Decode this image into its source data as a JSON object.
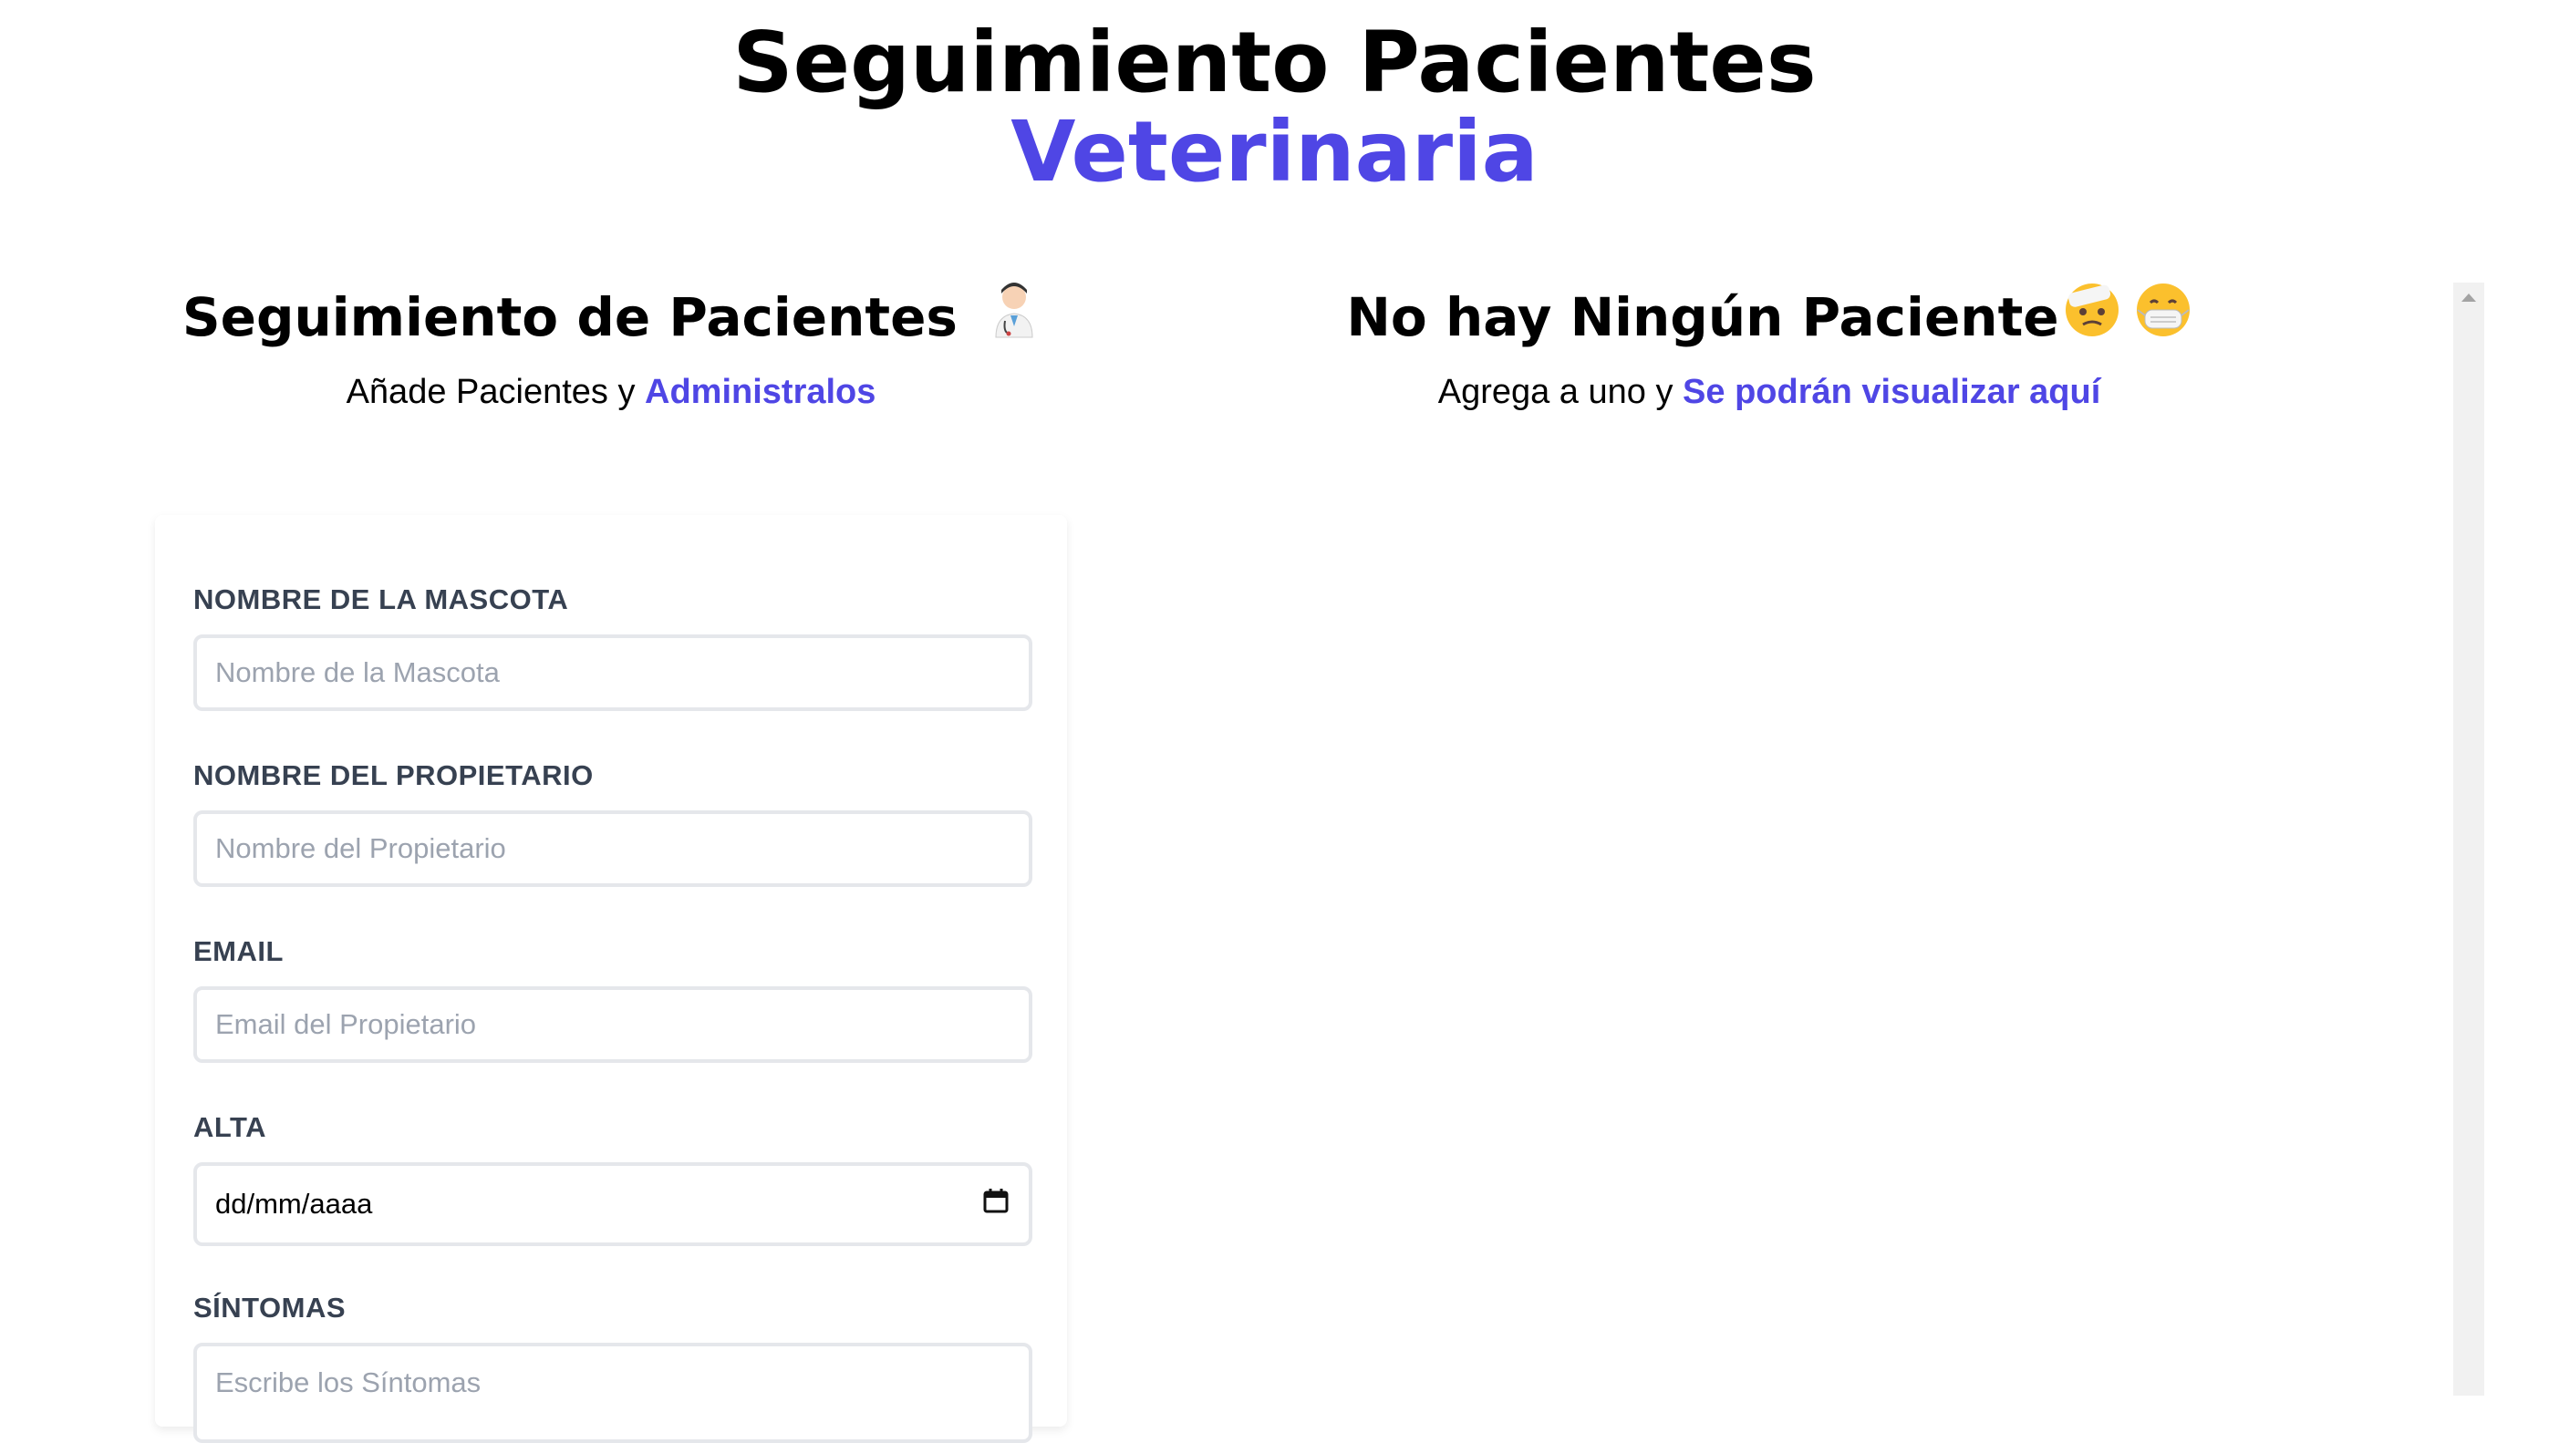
{
  "header": {
    "title": "Seguimiento Pacientes",
    "accent": "Veterinaria"
  },
  "left": {
    "title": "Seguimiento de Pacientes",
    "subtitle_prefix": "Añade Pacientes y ",
    "subtitle_link": "Administralos",
    "emoji": "doctor-icon"
  },
  "right": {
    "title": "No hay Ningún Paciente",
    "subtitle_prefix": "Agrega a uno y ",
    "subtitle_link": "Se podrán visualizar aquí",
    "emojis": [
      "bandaged-face-icon",
      "mask-face-icon"
    ]
  },
  "form": {
    "pet_label": "NOMBRE DE LA MASCOTA",
    "pet_placeholder": "Nombre de la Mascota",
    "owner_label": "NOMBRE DEL PROPIETARIO",
    "owner_placeholder": "Nombre del Propietario",
    "email_label": "EMAIL",
    "email_placeholder": "Email del Propietario",
    "date_label": "ALTA",
    "date_value": "dd/mm/aaaa",
    "symptoms_label": "SÍNTOMAS",
    "symptoms_placeholder": "Escribe los Síntomas"
  },
  "colors": {
    "accent": "#4f46e5",
    "label": "#374151",
    "placeholder": "#9ca3af",
    "border": "#e5e7eb"
  }
}
